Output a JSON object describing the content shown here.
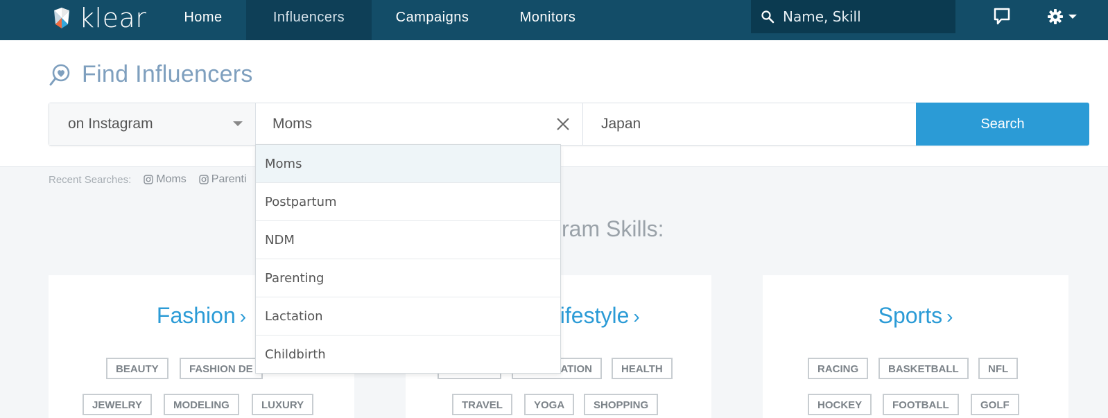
{
  "nav": {
    "logo_text": "klear",
    "items": [
      {
        "label": "Home"
      },
      {
        "label": "Influencers",
        "active": true
      },
      {
        "label": "Campaigns"
      },
      {
        "label": "Monitors"
      }
    ],
    "search_placeholder": "Name, Skill",
    "icons": [
      "search-icon",
      "chat-icon",
      "gear-icon",
      "caret-down-icon"
    ]
  },
  "header": {
    "title": "Find Influencers"
  },
  "search": {
    "platform": "on Instagram",
    "skill_value": "Moms",
    "location_value": "Japan",
    "button_label": "Search"
  },
  "dropdown": {
    "items": [
      "Moms",
      "Postpartum",
      "NDM",
      "Parenting",
      "Lactation",
      "Childbirth"
    ]
  },
  "recent": {
    "label": "Recent Searches:",
    "items": [
      "Moms",
      "Parenti"
    ]
  },
  "popular": {
    "heading_visible": "ram Skills:"
  },
  "cards": [
    {
      "title": "Fashion",
      "tags": [
        "BEAUTY",
        "FASHION DE",
        "JEWELRY",
        "MODELING",
        "LUXURY"
      ]
    },
    {
      "title": "Lifestyle",
      "tags": [
        "ATION",
        "HEALTH",
        "TRAVEL",
        "YOGA",
        "SHOPPING"
      ]
    },
    {
      "title": "Sports",
      "tags": [
        "RACING",
        "BASKETBALL",
        "NFL",
        "HOCKEY",
        "FOOTBALL",
        "GOLF"
      ]
    }
  ],
  "colors": {
    "nav_bg": "#134d68",
    "accent": "#2b9bd6",
    "title": "#7e9fbe"
  }
}
